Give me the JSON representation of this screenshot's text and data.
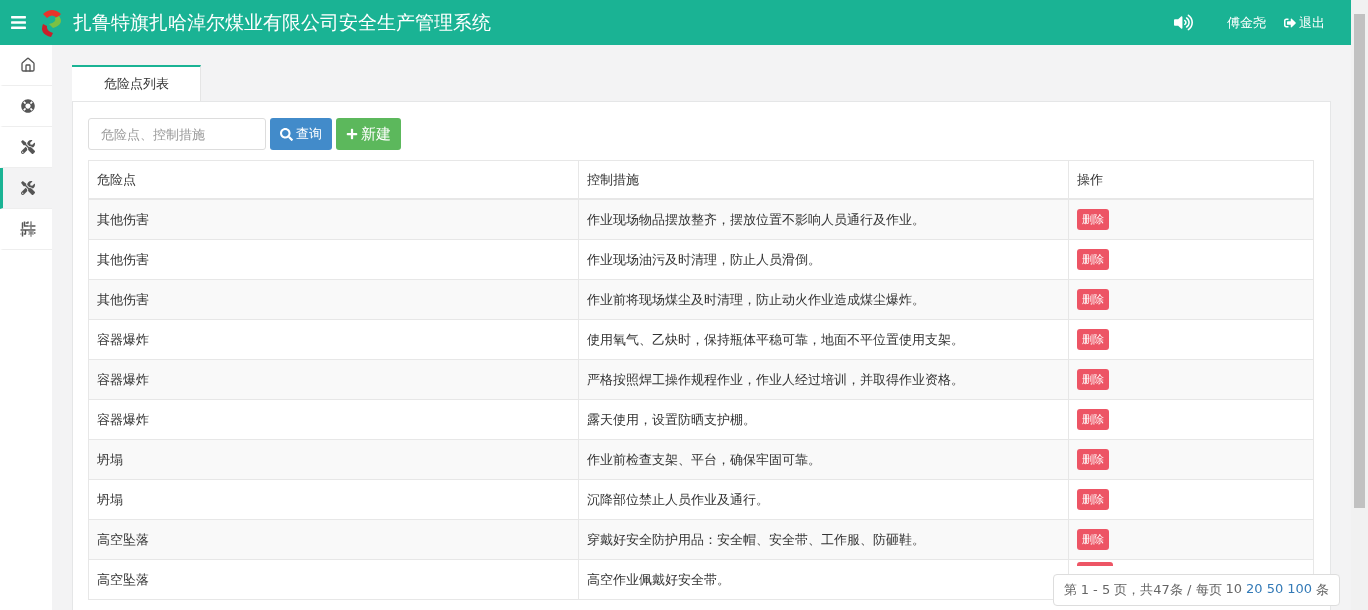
{
  "header": {
    "title": "扎鲁特旗扎哈淖尔煤业有限公司安全生产管理系统",
    "user": "傅金尧",
    "logout": "退出"
  },
  "sidebar": {
    "items": [
      {
        "selected": false
      },
      {
        "selected": false
      },
      {
        "selected": false
      },
      {
        "selected": true
      },
      {
        "selected": false
      }
    ]
  },
  "tabs": [
    {
      "label": "危险点列表",
      "selected": true
    }
  ],
  "search": {
    "placeholder": "危险点、控制措施"
  },
  "buttons": {
    "query": "查询",
    "create": "新建"
  },
  "table": {
    "columns": [
      "危险点",
      "控制措施",
      "操作"
    ],
    "rows": [
      {
        "hazard": "其他伤害",
        "measure": "作业现场物品摆放整齐，摆放位置不影响人员通行及作业。",
        "action": "删除"
      },
      {
        "hazard": "其他伤害",
        "measure": "作业现场油污及时清理，防止人员滑倒。",
        "action": "删除"
      },
      {
        "hazard": "其他伤害",
        "measure": "作业前将现场煤尘及时清理，防止动火作业造成煤尘爆炸。",
        "action": "删除"
      },
      {
        "hazard": "容器爆炸",
        "measure": "使用氧气、乙炔时，保持瓶体平稳可靠，地面不平位置使用支架。",
        "action": "删除"
      },
      {
        "hazard": "容器爆炸",
        "measure": "严格按照焊工操作规程作业，作业人经过培训，并取得作业资格。",
        "action": "删除"
      },
      {
        "hazard": "容器爆炸",
        "measure": "露天使用，设置防晒支护棚。",
        "action": "删除"
      },
      {
        "hazard": "坍塌",
        "measure": "作业前检查支架、平台，确保牢固可靠。",
        "action": "删除"
      },
      {
        "hazard": "坍塌",
        "measure": "沉降部位禁止人员作业及通行。",
        "action": "删除"
      },
      {
        "hazard": "高空坠落",
        "measure": "穿戴好安全防护用品：安全帽、安全带、工作服、防砸鞋。",
        "action": "删除"
      },
      {
        "hazard": "高空坠落",
        "measure": "高空作业佩戴好安全带。"
      }
    ]
  },
  "pager": {
    "summary": "第 1 - 5 页，共47条 / 每页",
    "sizes": [
      {
        "label": "10",
        "selected": true
      },
      {
        "label": "20",
        "selected": false
      },
      {
        "label": "50",
        "selected": false
      },
      {
        "label": "100",
        "selected": false
      }
    ],
    "unit": "条"
  }
}
